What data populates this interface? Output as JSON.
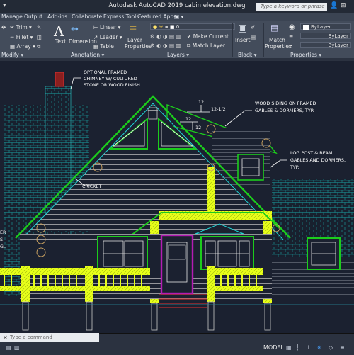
{
  "window": {
    "title": "Autodesk AutoCAD 2019   cabin elevation.dwg",
    "search_placeholder": "Type a keyword or phrase"
  },
  "tabs": [
    "Manage",
    "Output",
    "Add-ins",
    "Collaborate",
    "Express Tools",
    "Featured Apps"
  ],
  "ribbon": {
    "modify": {
      "trim": "Trim",
      "fillet": "Fillet",
      "array": "Array",
      "panel": "Modify"
    },
    "annotation": {
      "text": "Text",
      "dimension": "Dimension",
      "linear": "Linear",
      "leader": "Leader",
      "table": "Table",
      "panel": "Annotation"
    },
    "layers": {
      "layer_properties_line1": "Layer",
      "layer_properties_line2": "Properties",
      "layer_value": "0",
      "make_current": "Make Current",
      "match_layer": "Match Layer",
      "panel": "Layers"
    },
    "block": {
      "insert": "Insert",
      "panel": "Block"
    },
    "properties": {
      "match_line1": "Match",
      "match_line2": "Properties",
      "bylayer1": "ByLayer",
      "bylayer2": "ByLayer",
      "bylayer3": "ByLayer",
      "panel": "Properties"
    },
    "colors": {
      "accent_yellow": "#e8ff1a",
      "cyan": "#1fd6d6",
      "green": "#1ccc1c",
      "magenta": "#b41cb4"
    }
  },
  "drawing": {
    "note_chimney": [
      "OPTIONAL FRAMED",
      "CHIMNEY W/ CULTURED",
      "STONE OR WOOD FINISH."
    ],
    "note_siding": [
      "WOOD SIDING ON FRAMED",
      "GABLES & DORMERS, TYP."
    ],
    "note_log": [
      "LOG POST & BEAM",
      "GABLES AND DORMERS,",
      "TYP."
    ],
    "note_cricket": "CRICKET",
    "pitch_12a": "12",
    "pitch_12_half": "12-1/2",
    "pitch_12b": "12",
    "pitch_12c": "12",
    "left_note_fragment": [
      "ER",
      "S",
      "G.."
    ]
  },
  "status": {
    "command_placeholder": "Type a command",
    "model": "MODEL"
  }
}
